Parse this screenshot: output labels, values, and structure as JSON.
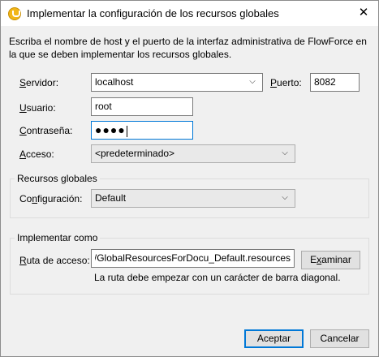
{
  "window": {
    "title": "Implementar la configuración de los recursos globales",
    "close_glyph": "✕"
  },
  "description": "Escriba el nombre de host y el puerto de la interfaz administrativa de FlowForce en la que se deben implementar los recursos globales.",
  "connection": {
    "server_label_mnemonic": "S",
    "server_label_rest": "ervidor:",
    "server_value": "localhost",
    "port_label_mnemonic": "P",
    "port_label_rest": "uerto:",
    "port_value": "8082",
    "user_label_mnemonic": "U",
    "user_label_rest": "suario:",
    "user_value": "root",
    "password_label_mnemonic": "C",
    "password_label_rest": "ontraseña:",
    "password_mask": "●●●●",
    "access_label_mnemonic": "A",
    "access_label_rest": "cceso:",
    "access_value": "<predeterminado>"
  },
  "global_resources": {
    "group_title": "Recursos globales",
    "config_label_mnemonic": "n",
    "config_label_pre": "Co",
    "config_label_rest": "figuración:",
    "config_value": "Default"
  },
  "deploy_as": {
    "group_title": "Implementar como",
    "path_label_mnemonic": "R",
    "path_label_rest": "uta de acceso:",
    "path_value": "public/GlobalResourcesForDocu_Default.resources",
    "browse_label_pre": "E",
    "browse_label_mnemonic": "x",
    "browse_label_rest": "aminar",
    "hint": "La ruta debe empezar con un carácter de barra diagonal."
  },
  "footer": {
    "ok_label": "Aceptar",
    "cancel_label": "Cancelar"
  },
  "icons": {
    "app": "altova-app-icon",
    "chevron": "chevron-down-icon",
    "close": "close-icon"
  }
}
